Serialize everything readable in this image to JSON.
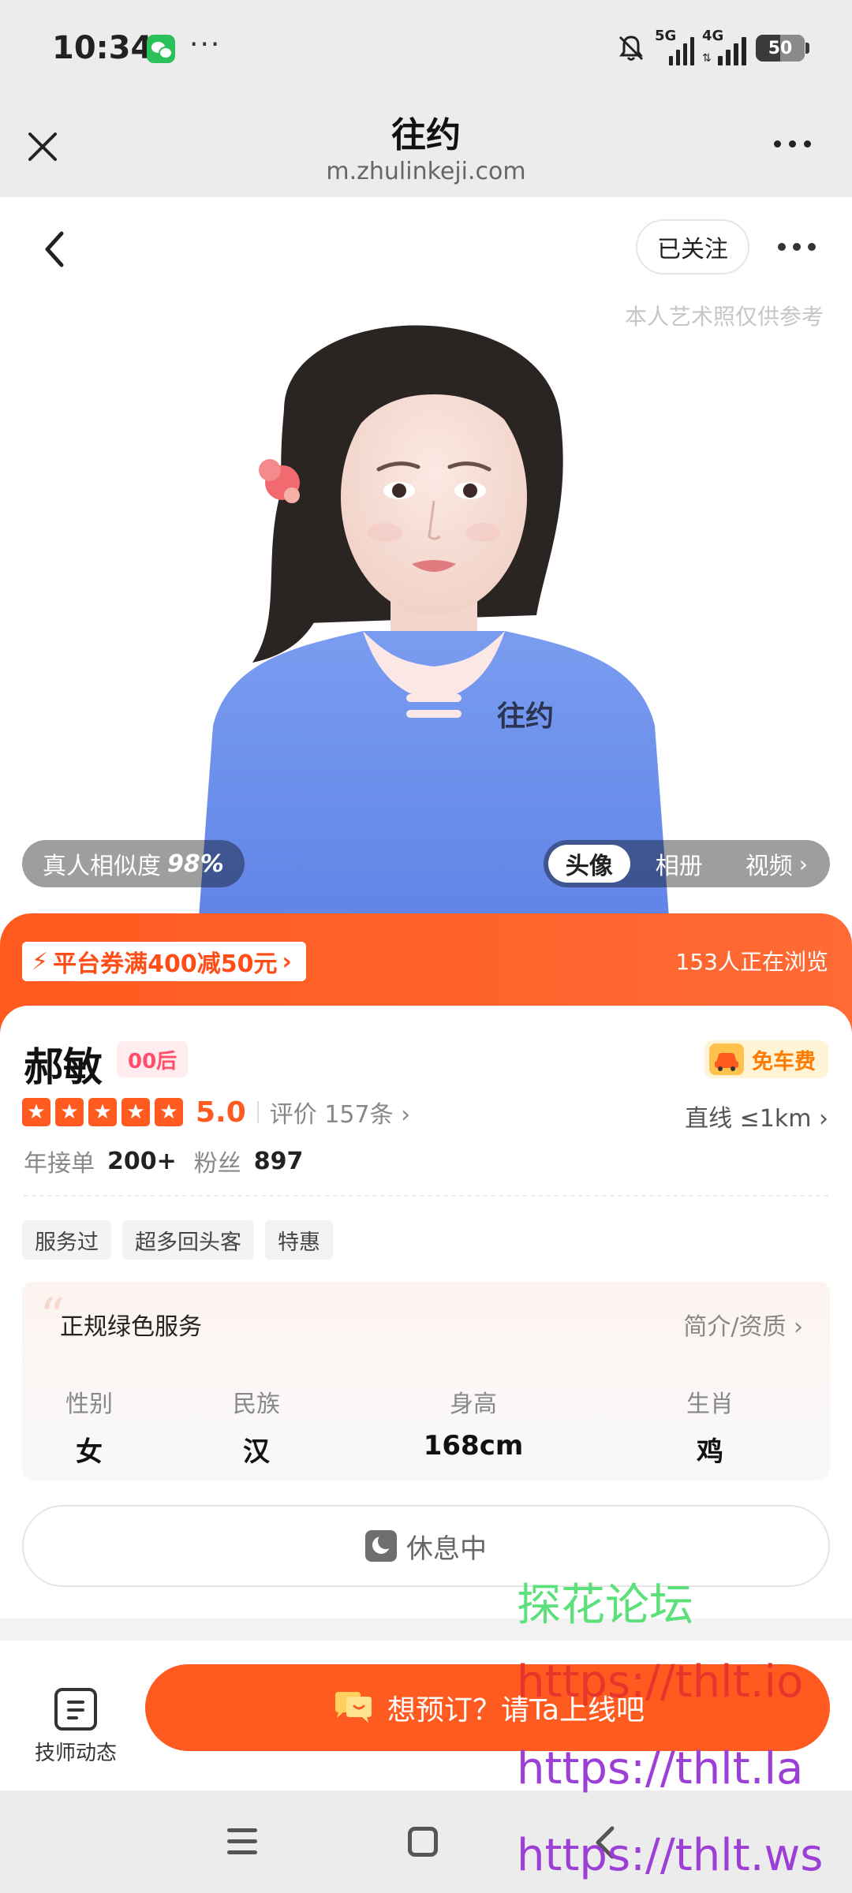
{
  "status_bar": {
    "time": "10:34",
    "dots": "···",
    "signal_1": "5G",
    "signal_2": "4G",
    "battery": "50"
  },
  "browser": {
    "title": "往约",
    "url": "m.zhulinkeji.com"
  },
  "hero": {
    "follow_label": "已关注",
    "art_note": "本人艺术照仅供参考",
    "similarity_label": "真人相似度",
    "similarity_value": "98%",
    "media_tabs": [
      "头像",
      "相册",
      "视频"
    ],
    "media_tab_active": "头像"
  },
  "promo": {
    "coupon": "平台券满400减50元",
    "browsing": "153人正在浏览"
  },
  "profile": {
    "name": "郝敏",
    "generation": "00后",
    "free_car": "免车费",
    "star_rating": 5,
    "score": "5.0",
    "reviews": "评价 157条",
    "distance": "直线 ≤1km",
    "stats": [
      {
        "label": "年接单",
        "value": "200+"
      },
      {
        "label": "粉丝",
        "value": "897"
      }
    ],
    "tags": [
      "服务过",
      "超多回头客",
      "特惠"
    ]
  },
  "intro_panel": {
    "title": "正规绿色服务",
    "link": "简介/资质",
    "attributes": [
      {
        "label": "性别",
        "value": "女"
      },
      {
        "label": "民族",
        "value": "汉"
      },
      {
        "label": "身高",
        "value": "168cm"
      },
      {
        "label": "生肖",
        "value": "鸡"
      }
    ]
  },
  "rest_status": "休息中",
  "action_bar": {
    "tech_label": "技师动态",
    "book_label": "想预订？请Ta上线吧"
  },
  "watermark": {
    "line_1": "探花论坛",
    "line_2": "https://thlt.io",
    "line_3": "https://thlt.la",
    "line_4": "https://thlt.ws"
  },
  "colors": {
    "accent": "#ff5a1f",
    "badge_pink": "#ff4d6a",
    "free_car_orange": "#ff7a00",
    "wechat_green": "#2bc15a"
  }
}
